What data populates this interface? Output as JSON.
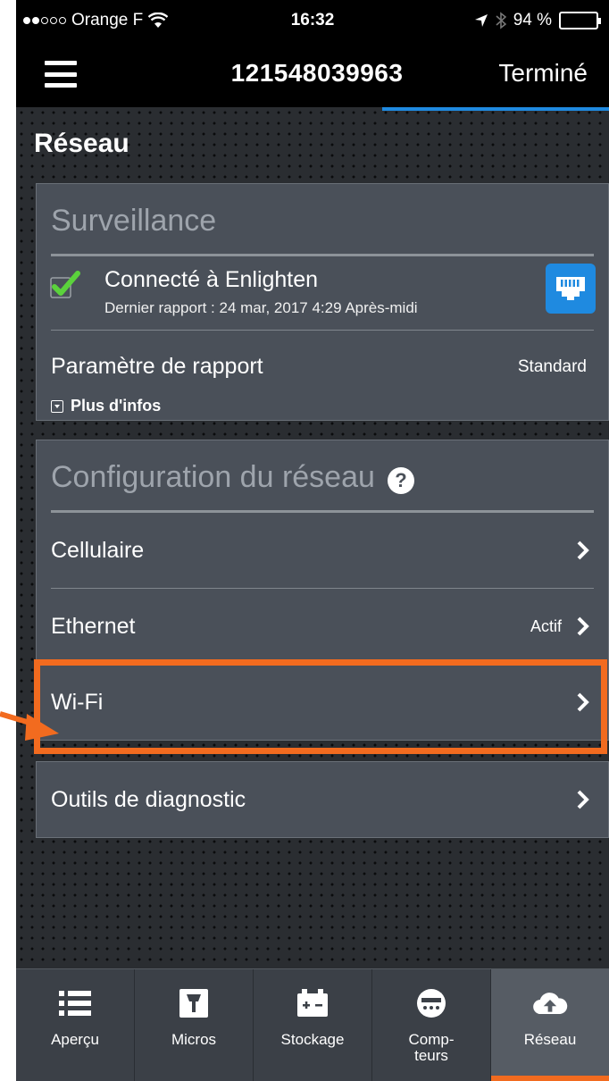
{
  "status_bar": {
    "carrier": "Orange F",
    "time": "16:32",
    "battery": "94 %",
    "battery_level": 0.94
  },
  "nav_bar": {
    "title": "121548039963",
    "done_label": "Terminé"
  },
  "page_title": "Réseau",
  "surveillance": {
    "header": "Surveillance",
    "connection_title": "Connecté à Enlighten",
    "last_report": "Dernier rapport : 24 mar, 2017 4:29 Après-midi",
    "report_label": "Paramètre de rapport",
    "report_value": "Standard",
    "more_info": "Plus d'infos"
  },
  "network_config": {
    "header": "Configuration du réseau",
    "help_symbol": "?",
    "rows": [
      {
        "label": "Cellulaire",
        "status": ""
      },
      {
        "label": "Ethernet",
        "status": "Actif"
      },
      {
        "label": "Wi-Fi",
        "status": ""
      }
    ]
  },
  "diagnostics": {
    "label": "Outils de diagnostic"
  },
  "tabs": [
    {
      "label": "Aperçu",
      "icon": "list-icon"
    },
    {
      "label": "Micros",
      "icon": "microinverter-icon"
    },
    {
      "label": "Stockage",
      "icon": "battery-icon"
    },
    {
      "label": "Comp-\nteurs",
      "icon": "meter-icon"
    },
    {
      "label": "Réseau",
      "icon": "cloud-upload-icon",
      "active": true
    }
  ],
  "colors": {
    "accent_blue": "#1f8ae0",
    "highlight_orange": "#f26b1f",
    "check_green": "#5bd23c"
  }
}
